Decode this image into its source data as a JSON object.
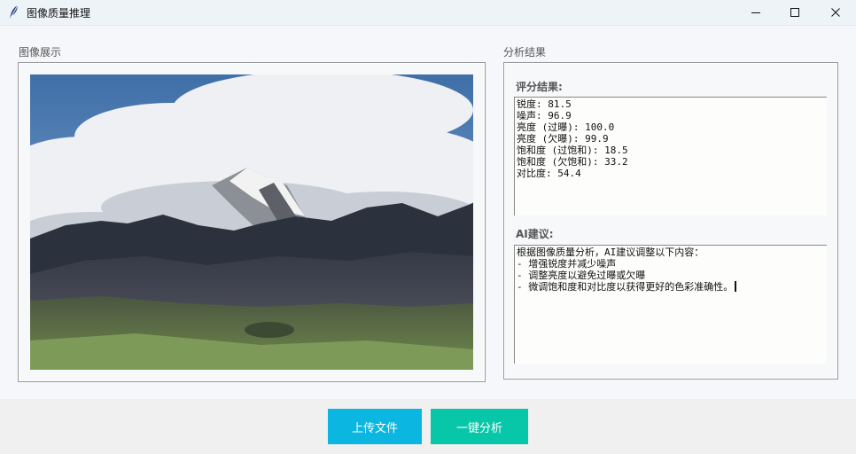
{
  "window": {
    "title": "图像质量推理",
    "app_icon": "quill-icon",
    "controls": [
      "minimize-icon",
      "maximize-icon",
      "close-icon"
    ]
  },
  "left_panel": {
    "label": "图像展示",
    "image_subject": "mountain-landscape-photo"
  },
  "right_panel": {
    "label": "分析结果",
    "score": {
      "heading": "评分结果:",
      "lines": [
        "锐度: 81.5",
        "噪声: 96.9",
        "亮度 (过曝): 100.0",
        "亮度 (欠曝): 99.9",
        "饱和度 (过饱和): 18.5",
        "饱和度 (欠饱和): 33.2",
        "对比度: 54.4"
      ]
    },
    "ai": {
      "heading": "AI建议:",
      "lines": [
        "根据图像质量分析，AI建议调整以下内容：",
        "- 增强锐度并减少噪声",
        "- 调整亮度以避免过曝或欠曝",
        "- 微调饱和度和对比度以获得更好的色彩准确性。"
      ]
    }
  },
  "buttons": {
    "upload": "上传文件",
    "analyze": "一键分析"
  },
  "colors": {
    "upload_button": "#0bb6e0",
    "analyze_button": "#08c6a8",
    "titlebar": "#eef3f8"
  }
}
